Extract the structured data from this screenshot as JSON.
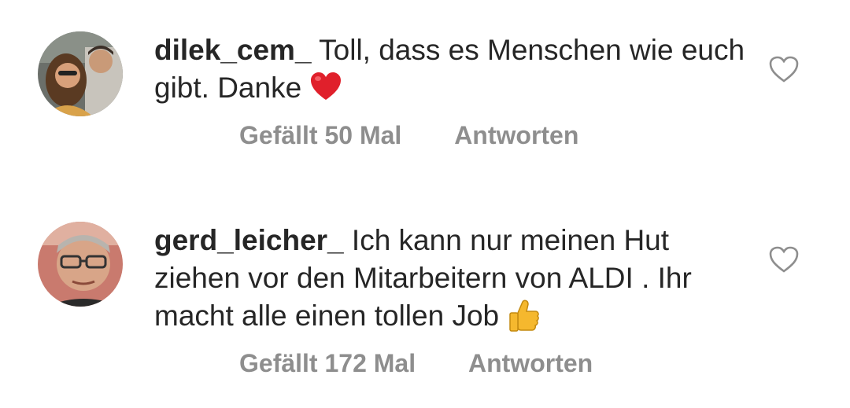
{
  "comments": [
    {
      "username": "dilek_cem_",
      "text": "Toll, dass es Menschen wie euch gibt. Danke",
      "emoji_icon": "red-heart-emoji",
      "likes": "Gefällt 50 Mal",
      "reply": "Antworten",
      "like_icon": "heart-outline-icon"
    },
    {
      "username": "gerd_leicher_",
      "text": "Ich kann nur meinen Hut ziehen vor den Mitarbeitern von ALDI . Ihr macht alle einen tollen Job",
      "emoji_icon": "thumbs-up-emoji",
      "likes": "Gefällt 172 Mal",
      "reply": "Antworten",
      "like_icon": "heart-outline-icon"
    }
  ],
  "colors": {
    "text": "#262626",
    "secondary": "#8e8e8e",
    "heart_emoji": "#e0202b",
    "thumb_emoji": "#f5b82e"
  }
}
